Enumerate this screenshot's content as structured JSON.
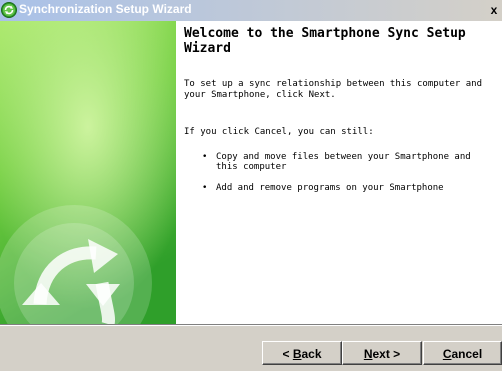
{
  "window": {
    "title": "Synchronization Setup Wizard",
    "close_label": "x"
  },
  "content": {
    "heading": "Welcome to the Smartphone Sync Setup Wizard",
    "para1": "To set up a sync relationship between this computer and your Smartphone, click Next.",
    "para2": "If you click Cancel, you can still:",
    "bullets": [
      "Copy and move files between your Smartphone and this computer",
      "Add and remove programs on your Smartphone"
    ]
  },
  "buttons": {
    "back": {
      "pre": "< ",
      "accel": "B",
      "post": "ack"
    },
    "next": {
      "accel": "N",
      "post": "ext >"
    },
    "cancel": {
      "accel": "C",
      "post": "ancel"
    }
  },
  "colors": {
    "title_bar_gradient_start": "#a9c1e8",
    "banner_green_light": "#b8ec7a",
    "banner_green_dark": "#2fa02a",
    "chrome": "#d4d0c8"
  },
  "icons": {
    "title": "sync-arrows-icon",
    "banner": "sync-arrows-icon"
  }
}
